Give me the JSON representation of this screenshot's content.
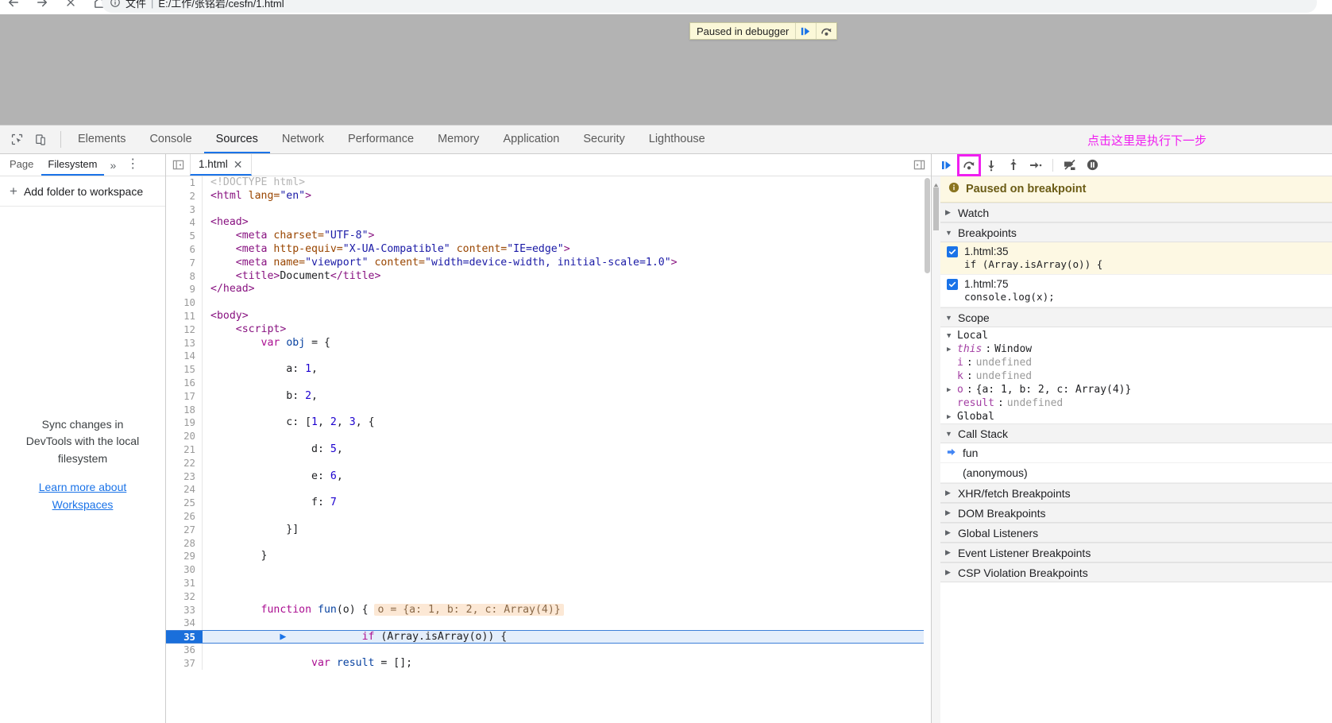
{
  "browser": {
    "nav": {
      "back_icon": "arrow-left-icon",
      "forward_icon": "arrow-right-icon",
      "stop_icon": "close-icon",
      "home_icon": "home-icon"
    },
    "omnibox": {
      "info_icon": "info-circle-icon",
      "site_label": "文件",
      "separator": "|",
      "url": "E:/工作/张铭岩/cesfn/1.html"
    }
  },
  "page_overlay": {
    "paused_banner": {
      "label": "Paused in debugger",
      "resume_icon": "resume-script-icon",
      "step_over_icon": "step-over-icon"
    }
  },
  "devtools": {
    "tool_icons": [
      {
        "name": "inspect-element-icon"
      },
      {
        "name": "device-toolbar-icon"
      }
    ],
    "tabs": [
      {
        "label": "Elements",
        "active": false
      },
      {
        "label": "Console",
        "active": false
      },
      {
        "label": "Sources",
        "active": true
      },
      {
        "label": "Network",
        "active": false
      },
      {
        "label": "Performance",
        "active": false
      },
      {
        "label": "Memory",
        "active": false
      },
      {
        "label": "Application",
        "active": false
      },
      {
        "label": "Security",
        "active": false
      },
      {
        "label": "Lighthouse",
        "active": false
      }
    ],
    "annotation": "点击这里是执行下一步"
  },
  "navigator": {
    "tabs": [
      {
        "label": "Page",
        "active": false
      },
      {
        "label": "Filesystem",
        "active": true
      }
    ],
    "more_icon": "chevron-double-right-icon",
    "kebab_icon": "more-options-icon",
    "add_folder": {
      "plus": "+",
      "label": "Add folder to workspace"
    },
    "empty_state": {
      "text": "Sync changes in DevTools with the local filesystem",
      "link_line1": "Learn more about",
      "link_line2": "Workspaces"
    }
  },
  "editor": {
    "collapse_left_icon": "panel-collapse-left-icon",
    "expand_right_icon": "panel-expand-right-icon",
    "file_tab": {
      "name": "1.html",
      "close": "✕"
    },
    "lines": [
      {
        "n": 1,
        "tokens": [
          {
            "t": "cmt",
            "s": "<!DOCTYPE html>"
          }
        ]
      },
      {
        "n": 2,
        "tokens": [
          {
            "t": "tag",
            "s": "<html "
          },
          {
            "t": "attr",
            "s": "lang="
          },
          {
            "t": "str",
            "s": "\"en\""
          },
          {
            "t": "tag",
            "s": ">"
          }
        ]
      },
      {
        "n": 3,
        "tokens": []
      },
      {
        "n": 4,
        "tokens": [
          {
            "t": "tag",
            "s": "<head>"
          }
        ]
      },
      {
        "n": 5,
        "tokens": [
          {
            "t": "plain",
            "s": "    "
          },
          {
            "t": "tag",
            "s": "<meta "
          },
          {
            "t": "attr",
            "s": "charset="
          },
          {
            "t": "str",
            "s": "\"UTF-8\""
          },
          {
            "t": "tag",
            "s": ">"
          }
        ]
      },
      {
        "n": 6,
        "tokens": [
          {
            "t": "plain",
            "s": "    "
          },
          {
            "t": "tag",
            "s": "<meta "
          },
          {
            "t": "attr",
            "s": "http-equiv="
          },
          {
            "t": "str",
            "s": "\"X-UA-Compatible\""
          },
          {
            "t": "plain",
            "s": " "
          },
          {
            "t": "attr",
            "s": "content="
          },
          {
            "t": "str",
            "s": "\"IE=edge\""
          },
          {
            "t": "tag",
            "s": ">"
          }
        ]
      },
      {
        "n": 7,
        "tokens": [
          {
            "t": "plain",
            "s": "    "
          },
          {
            "t": "tag",
            "s": "<meta "
          },
          {
            "t": "attr",
            "s": "name="
          },
          {
            "t": "str",
            "s": "\"viewport\""
          },
          {
            "t": "plain",
            "s": " "
          },
          {
            "t": "attr",
            "s": "content="
          },
          {
            "t": "str",
            "s": "\"width=device-width, initial-scale=1.0\""
          },
          {
            "t": "tag",
            "s": ">"
          }
        ]
      },
      {
        "n": 8,
        "tokens": [
          {
            "t": "plain",
            "s": "    "
          },
          {
            "t": "tag",
            "s": "<title>"
          },
          {
            "t": "plain",
            "s": "Document"
          },
          {
            "t": "tag",
            "s": "</title>"
          }
        ]
      },
      {
        "n": 9,
        "tokens": [
          {
            "t": "tag",
            "s": "</head>"
          }
        ]
      },
      {
        "n": 10,
        "tokens": []
      },
      {
        "n": 11,
        "tokens": [
          {
            "t": "tag",
            "s": "<body>"
          }
        ]
      },
      {
        "n": 12,
        "tokens": [
          {
            "t": "plain",
            "s": "    "
          },
          {
            "t": "tag",
            "s": "<script>"
          }
        ]
      },
      {
        "n": 13,
        "tokens": [
          {
            "t": "plain",
            "s": "        "
          },
          {
            "t": "kw",
            "s": "var"
          },
          {
            "t": "plain",
            "s": " "
          },
          {
            "t": "var",
            "s": "obj"
          },
          {
            "t": "plain",
            "s": " = {"
          }
        ]
      },
      {
        "n": 14,
        "tokens": []
      },
      {
        "n": 15,
        "tokens": [
          {
            "t": "plain",
            "s": "            a: "
          },
          {
            "t": "num",
            "s": "1"
          },
          {
            "t": "plain",
            "s": ","
          }
        ]
      },
      {
        "n": 16,
        "tokens": []
      },
      {
        "n": 17,
        "tokens": [
          {
            "t": "plain",
            "s": "            b: "
          },
          {
            "t": "num",
            "s": "2"
          },
          {
            "t": "plain",
            "s": ","
          }
        ]
      },
      {
        "n": 18,
        "tokens": []
      },
      {
        "n": 19,
        "tokens": [
          {
            "t": "plain",
            "s": "            c: ["
          },
          {
            "t": "num",
            "s": "1"
          },
          {
            "t": "plain",
            "s": ", "
          },
          {
            "t": "num",
            "s": "2"
          },
          {
            "t": "plain",
            "s": ", "
          },
          {
            "t": "num",
            "s": "3"
          },
          {
            "t": "plain",
            "s": ", {"
          }
        ]
      },
      {
        "n": 20,
        "tokens": []
      },
      {
        "n": 21,
        "tokens": [
          {
            "t": "plain",
            "s": "                d: "
          },
          {
            "t": "num",
            "s": "5"
          },
          {
            "t": "plain",
            "s": ","
          }
        ]
      },
      {
        "n": 22,
        "tokens": []
      },
      {
        "n": 23,
        "tokens": [
          {
            "t": "plain",
            "s": "                e: "
          },
          {
            "t": "num",
            "s": "6"
          },
          {
            "t": "plain",
            "s": ","
          }
        ]
      },
      {
        "n": 24,
        "tokens": []
      },
      {
        "n": 25,
        "tokens": [
          {
            "t": "plain",
            "s": "                f: "
          },
          {
            "t": "num",
            "s": "7"
          }
        ]
      },
      {
        "n": 26,
        "tokens": []
      },
      {
        "n": 27,
        "tokens": [
          {
            "t": "plain",
            "s": "            }]"
          }
        ]
      },
      {
        "n": 28,
        "tokens": []
      },
      {
        "n": 29,
        "tokens": [
          {
            "t": "plain",
            "s": "        }"
          }
        ]
      },
      {
        "n": 30,
        "tokens": []
      },
      {
        "n": 31,
        "tokens": []
      },
      {
        "n": 32,
        "tokens": []
      },
      {
        "n": 33,
        "tokens": [
          {
            "t": "plain",
            "s": "        "
          },
          {
            "t": "kw",
            "s": "function"
          },
          {
            "t": "plain",
            "s": " "
          },
          {
            "t": "var",
            "s": "fun"
          },
          {
            "t": "plain",
            "s": "(o) { "
          }
        ],
        "inline_value": "o = {a: 1, b: 2, c: Array(4)}"
      },
      {
        "n": 34,
        "tokens": []
      },
      {
        "n": 35,
        "tokens": [
          {
            "t": "plain",
            "s": "            "
          },
          {
            "t": "kw",
            "s": "if"
          },
          {
            "t": "plain",
            "s": " (Array."
          },
          {
            "t": "plain",
            "s": "isArray(o)) {"
          }
        ],
        "paused": true
      },
      {
        "n": 36,
        "tokens": []
      },
      {
        "n": 37,
        "tokens": [
          {
            "t": "plain",
            "s": "                "
          },
          {
            "t": "kw",
            "s": "var"
          },
          {
            "t": "plain",
            "s": " "
          },
          {
            "t": "var",
            "s": "result"
          },
          {
            "t": "plain",
            "s": " = [];"
          }
        ]
      }
    ]
  },
  "debugger": {
    "toolbar": [
      {
        "name": "resume-script-execution",
        "icon": "resume-icon",
        "highlighted": false
      },
      {
        "name": "step-over-next-function-call",
        "icon": "step-over-icon",
        "highlighted": true
      },
      {
        "name": "step-into-next-function-call",
        "icon": "step-into-icon",
        "highlighted": false
      },
      {
        "name": "step-out-of-current-function",
        "icon": "step-out-icon",
        "highlighted": false
      },
      {
        "name": "step",
        "icon": "step-icon",
        "highlighted": false
      },
      {
        "name": "deactivate-breakpoints",
        "icon": "deactivate-breakpoints-icon",
        "highlighted": false
      },
      {
        "name": "pause-on-exceptions",
        "icon": "pause-on-exceptions-icon",
        "highlighted": false
      }
    ],
    "status": {
      "icon": "info-icon",
      "text": "Paused on breakpoint"
    },
    "sections": {
      "watch": {
        "label": "Watch",
        "expanded": false
      },
      "breakpoints": {
        "label": "Breakpoints",
        "expanded": true,
        "items": [
          {
            "checked": true,
            "location": "1.html:35",
            "code": "if (Array.isArray(o)) {",
            "active": true
          },
          {
            "checked": true,
            "location": "1.html:75",
            "code": "console.log(x);",
            "active": false
          }
        ]
      },
      "scope": {
        "label": "Scope",
        "expanded": true,
        "local_label": "Local",
        "entries": [
          {
            "expandable": true,
            "name": "this",
            "italic": true,
            "value": "Window",
            "kind": "object"
          },
          {
            "expandable": false,
            "name": "i",
            "italic": false,
            "value": "undefined",
            "kind": "undefined"
          },
          {
            "expandable": false,
            "name": "k",
            "italic": false,
            "value": "undefined",
            "kind": "undefined"
          },
          {
            "expandable": true,
            "name": "o",
            "italic": false,
            "value": "{a: 1, b: 2, c: Array(4)}",
            "kind": "object"
          },
          {
            "expandable": false,
            "name": "result",
            "italic": false,
            "value": "undefined",
            "kind": "undefined"
          }
        ],
        "global_label": "Global",
        "global_expanded": false
      },
      "call_stack": {
        "label": "Call Stack",
        "expanded": true,
        "frames": [
          {
            "name": "fun",
            "current": true
          },
          {
            "name": "(anonymous)",
            "current": false
          }
        ]
      },
      "xhr_breakpoints": {
        "label": "XHR/fetch Breakpoints",
        "expanded": false
      },
      "dom_breakpoints": {
        "label": "DOM Breakpoints",
        "expanded": false
      },
      "global_listeners": {
        "label": "Global Listeners",
        "expanded": false
      },
      "event_listener_breakpoints": {
        "label": "Event Listener Breakpoints",
        "expanded": false
      },
      "csp_violation_breakpoints": {
        "label": "CSP Violation Breakpoints",
        "expanded": false
      }
    }
  },
  "colors": {
    "accent": "#1a73e8",
    "annotation": "#f01ff0",
    "paused_bg": "#fdf8e3",
    "viewport_grey": "#b3b3b3"
  }
}
